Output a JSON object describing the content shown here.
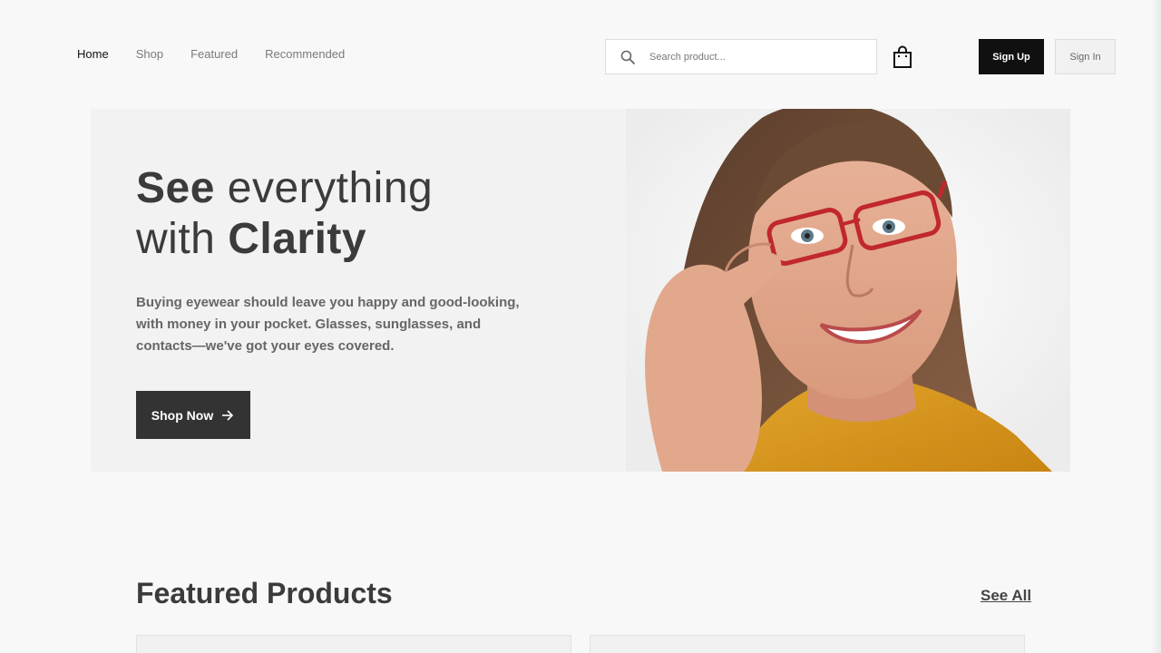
{
  "nav": {
    "items": [
      {
        "label": "Home",
        "active": true
      },
      {
        "label": "Shop",
        "active": false
      },
      {
        "label": "Featured",
        "active": false
      },
      {
        "label": "Recommended",
        "active": false
      }
    ]
  },
  "search": {
    "placeholder": "Search product...",
    "value": "",
    "icon": "search-icon"
  },
  "cart": {
    "icon": "shopping-bag-icon"
  },
  "auth": {
    "signup_label": "Sign Up",
    "signin_label": "Sign In"
  },
  "hero": {
    "title_line1_bold": "See",
    "title_line1_rest": " everything",
    "title_line2_rest": "with ",
    "title_line2_bold": "Clarity",
    "description": "Buying eyewear should leave you happy and good-looking, with money in your pocket. Glasses, sunglasses, and contacts—we've got your eyes covered.",
    "cta_label": "Shop Now",
    "cta_icon": "arrow-right-icon"
  },
  "featured": {
    "title": "Featured Products",
    "see_all": "See All"
  },
  "colors": {
    "primary": "#101010",
    "hero_bg": "#f2f2f2",
    "page_bg": "#f8f8f8",
    "accent_red": "#c0282e"
  }
}
